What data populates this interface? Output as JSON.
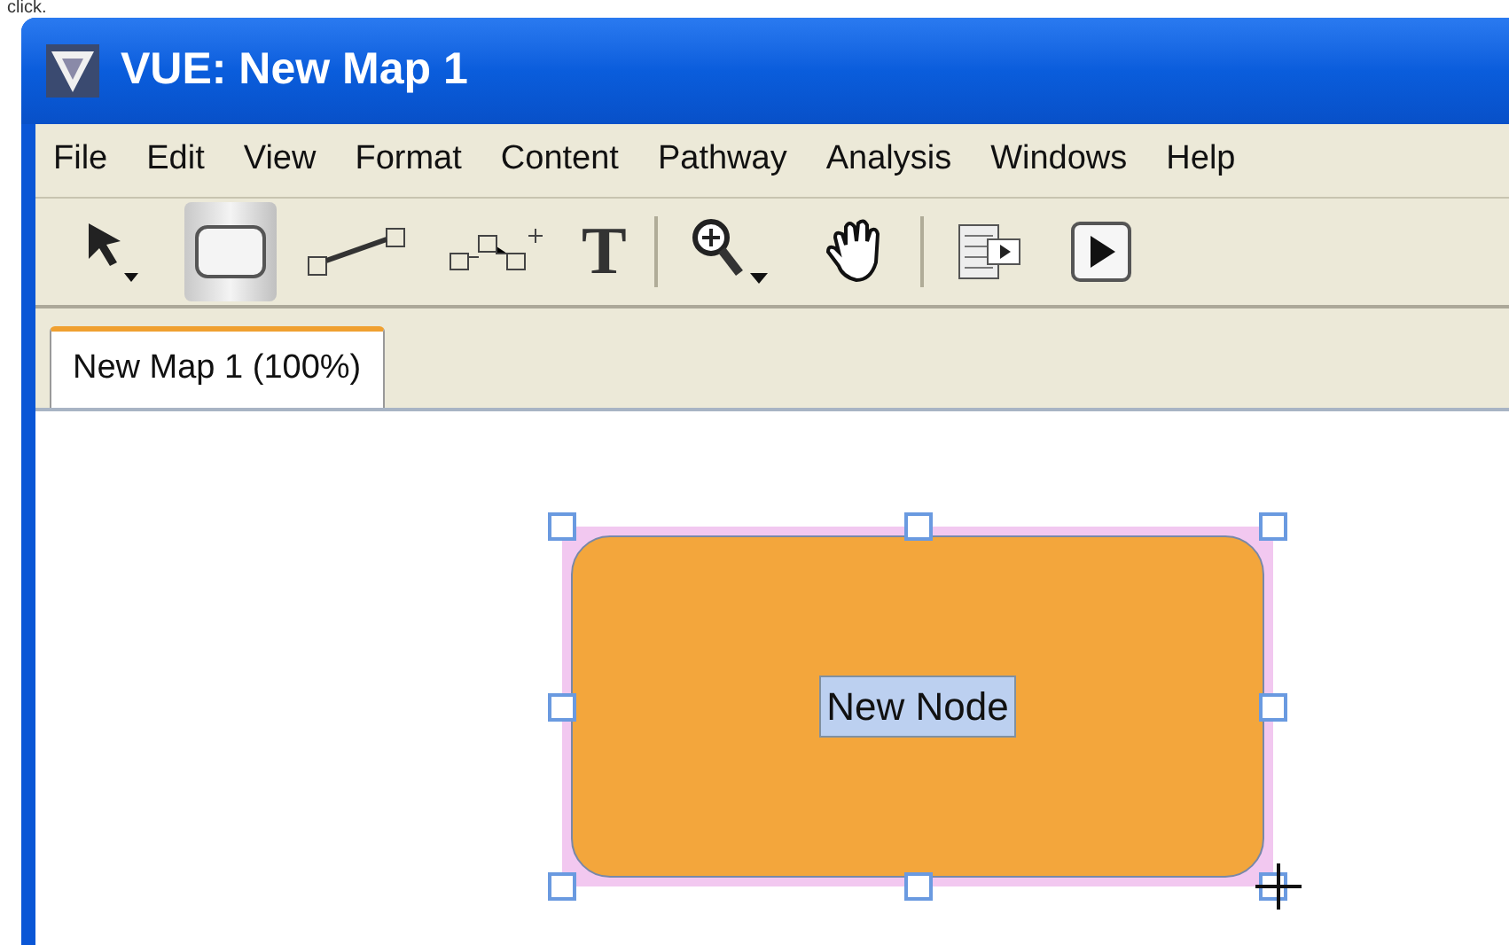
{
  "caption": "click.",
  "window": {
    "title": "VUE: New Map 1"
  },
  "menu": [
    "File",
    "Edit",
    "View",
    "Format",
    "Content",
    "Pathway",
    "Analysis",
    "Windows",
    "Help"
  ],
  "toolbar": [
    {
      "kind": "pointer",
      "selected": false
    },
    {
      "kind": "node",
      "selected": true
    },
    {
      "kind": "link",
      "selected": false
    },
    {
      "kind": "pathway",
      "selected": false
    },
    {
      "kind": "text",
      "label": "T",
      "selected": false
    },
    {
      "kind": "separator"
    },
    {
      "kind": "zoom",
      "selected": false
    },
    {
      "kind": "hand",
      "selected": false
    },
    {
      "kind": "separator"
    },
    {
      "kind": "slides",
      "selected": false
    },
    {
      "kind": "play",
      "selected": false
    }
  ],
  "tabs": [
    {
      "label": "New Map 1 (100%)",
      "selected": true
    }
  ],
  "node": {
    "label": "New Node",
    "selected": true,
    "label_selected": true
  }
}
